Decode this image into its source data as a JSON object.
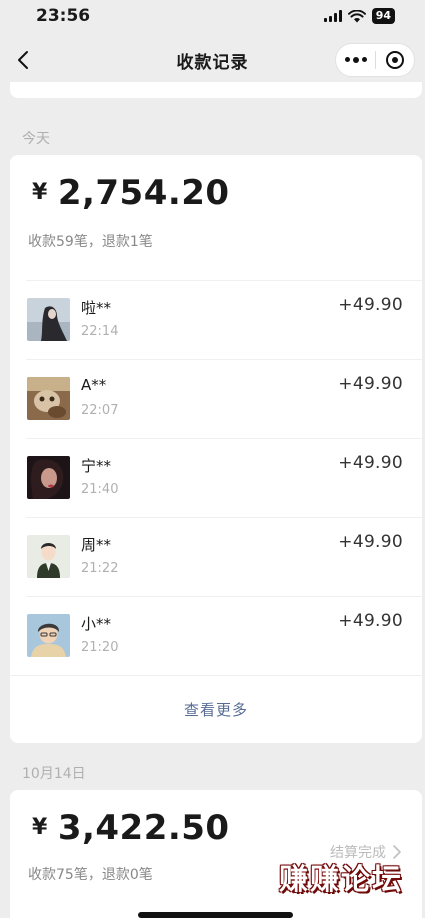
{
  "status": {
    "time": "23:56",
    "battery": "94"
  },
  "nav": {
    "title": "收款记录",
    "back_icon": "chevron-left-icon",
    "more_icon": "more-dots-icon",
    "close_icon": "target-circle-icon"
  },
  "today": {
    "label": "今天",
    "amount": "2,754.20",
    "currency": "¥",
    "detail": "收款59笔，退款1笔",
    "transactions": [
      {
        "name": "啦**",
        "time": "22:14",
        "amount": "+49.90",
        "avatar": "avatar-girl-dark-hair"
      },
      {
        "name": "A**",
        "time": "22:07",
        "amount": "+49.90",
        "avatar": "avatar-cat"
      },
      {
        "name": "宁**",
        "time": "21:40",
        "amount": "+49.90",
        "avatar": "avatar-woman-dark"
      },
      {
        "name": "周**",
        "time": "21:22",
        "amount": "+49.90",
        "avatar": "avatar-cartoon-man"
      },
      {
        "name": "小**",
        "time": "21:20",
        "amount": "+49.90",
        "avatar": "avatar-cartoon-boy"
      }
    ],
    "view_more": "查看更多"
  },
  "oct14": {
    "label": "10月14日",
    "amount": "3,422.50",
    "currency": "¥",
    "detail": "收款75笔，退款0笔",
    "settle_status": "结算完成"
  },
  "watermark": "赚赚论坛"
}
